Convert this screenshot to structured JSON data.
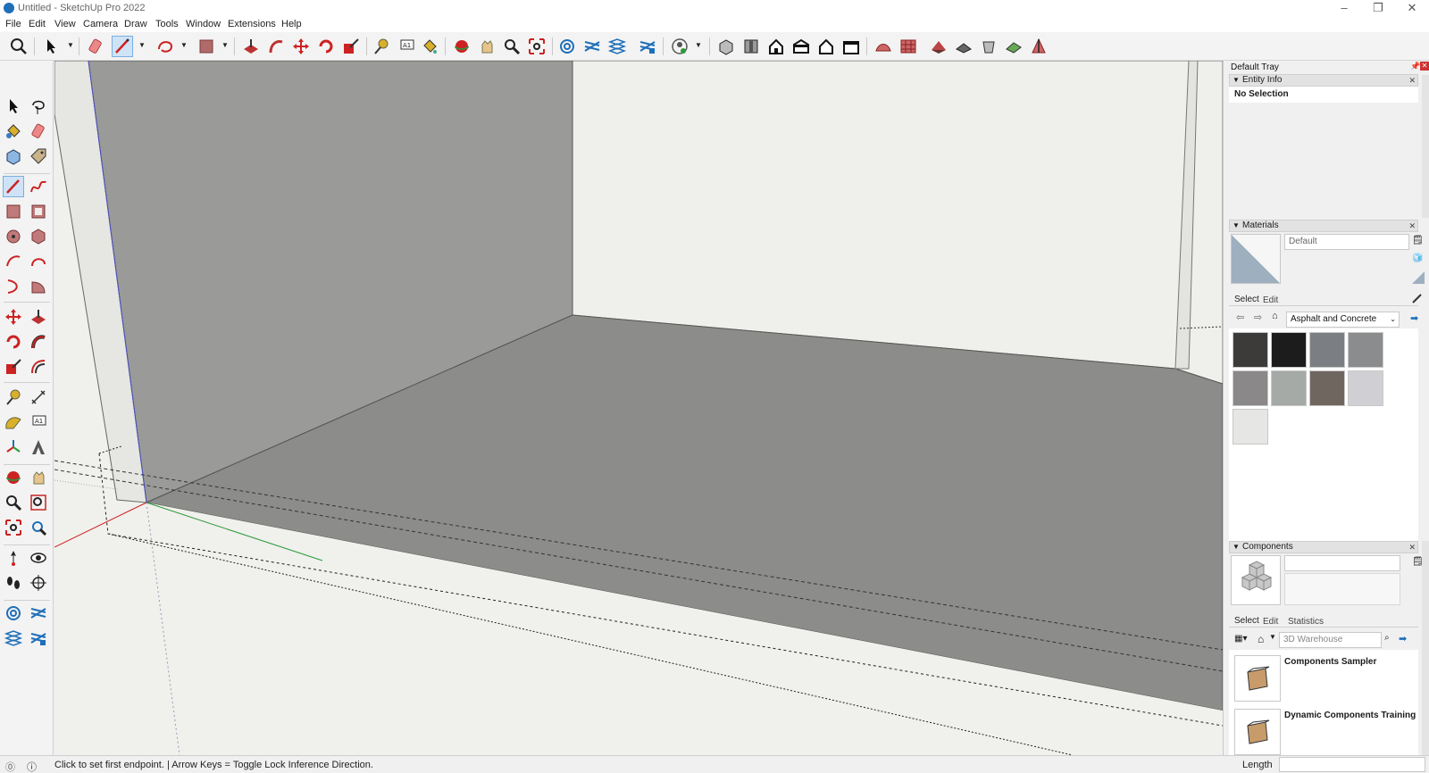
{
  "window": {
    "title": "Untitled - SketchUp Pro 2022"
  },
  "menu": [
    "File",
    "Edit",
    "View",
    "Camera",
    "Draw",
    "Tools",
    "Window",
    "Extensions",
    "Help"
  ],
  "tray": {
    "title": "Default Tray",
    "entity_info": {
      "header": "Entity Info",
      "status": "No Selection"
    },
    "materials": {
      "header": "Materials",
      "name_value": "Default",
      "tab_select": "Select",
      "tab_edit": "Edit",
      "library": "Asphalt and Concrete",
      "swatches": [
        "#3d3a3a",
        "#1c1c1c",
        "#7b7f83",
        "#8a8c8d",
        "#8a8888",
        "#a5aaa6",
        "#6f6660",
        "#d0d0d4",
        "#e6e6e4"
      ]
    },
    "components": {
      "header": "Components",
      "tab_select": "Select",
      "tab_edit": "Edit",
      "tab_statistics": "Statistics",
      "search_placeholder": "3D Warehouse",
      "items": [
        "Components Sampler",
        "Dynamic Components Training"
      ]
    }
  },
  "status": {
    "message": "Click to set first endpoint. | Arrow Keys = Toggle Lock Inference Direction.",
    "measure_label": "Length",
    "measure_value": ""
  },
  "colors": {
    "accent": "#1e6fb8",
    "floor": "#8c8c8a",
    "wall_left": "#9a9a98",
    "wall_right": "#efefeb",
    "sky": "#f0f0ec"
  }
}
